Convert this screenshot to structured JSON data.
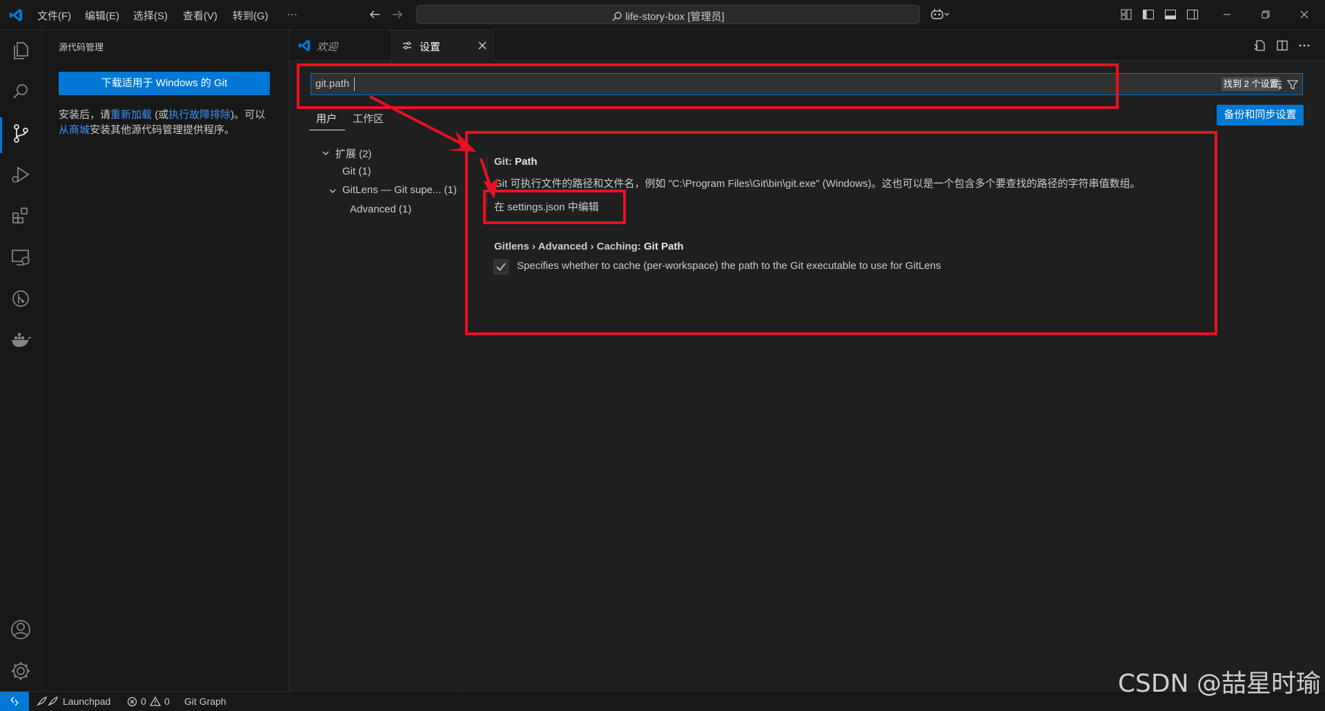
{
  "titlebar": {
    "menus": [
      "文件(F)",
      "编辑(E)",
      "选择(S)",
      "查看(V)",
      "转到(G)",
      "···"
    ],
    "search_text": "life-story-box [管理员]"
  },
  "sidebar": {
    "title": "源代码管理",
    "download_button": "下载适用于 Windows 的 Git",
    "text_1": "安装后，请",
    "link_reload": "重新加载",
    "text_2": " (或",
    "link_troubleshoot": "执行故障排除",
    "text_3": ")。可以",
    "link_marketplace": "从商城",
    "text_4": "安装其他源代码管理提供程序。"
  },
  "tabs": {
    "welcome": "欢迎",
    "settings": "设置"
  },
  "settings": {
    "search_value": "git.path",
    "found_badge": "找到 2 个设置",
    "scope_user": "用户",
    "scope_workspace": "工作区",
    "backup_button": "备份和同步设置",
    "tree": {
      "extensions": "扩展 (2)",
      "git": "Git (1)",
      "gitlens": "GitLens — Git supe... (1)",
      "advanced": "Advanced (1)"
    },
    "items": [
      {
        "category": "Git: ",
        "name": "Path",
        "description": "Git 可执行文件的路径和文件名，例如 \"C:\\Program Files\\Git\\bin\\git.exe\" (Windows)。这也可以是一个包含多个要查找的路径的字符串值数组。",
        "link": "在 settings.json 中编辑"
      },
      {
        "category": "Gitlens › Advanced › Caching: ",
        "name": "Git Path",
        "description": "Specifies whether to cache (per-workspace) the path to the Git executable to use for GitLens",
        "checked": true
      }
    ]
  },
  "statusbar": {
    "launchpad": "Launchpad",
    "errors": "0",
    "warnings": "0",
    "git_graph": "Git Graph"
  },
  "watermark": "CSDN @喆星时瑜",
  "colors": {
    "accent": "#0078d4",
    "annotation": "#e81123",
    "link": "#3794ff"
  }
}
